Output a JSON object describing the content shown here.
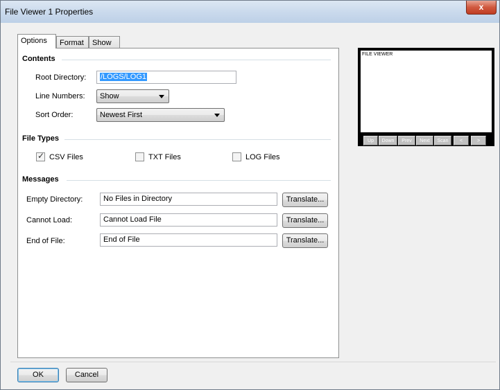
{
  "window": {
    "title": "File Viewer 1 Properties",
    "close_glyph": "x"
  },
  "tabs": [
    {
      "label": "Options",
      "active": true
    },
    {
      "label": "Format",
      "active": false
    },
    {
      "label": "Show",
      "active": false
    }
  ],
  "contents": {
    "heading": "Contents",
    "root_directory": {
      "label": "Root Directory:",
      "value": "/LOGS/LOG1"
    },
    "line_numbers": {
      "label": "Line Numbers:",
      "value": "Show"
    },
    "sort_order": {
      "label": "Sort Order:",
      "value": "Newest First"
    }
  },
  "file_types": {
    "heading": "File Types",
    "csv": {
      "label": "CSV Files",
      "checked": true
    },
    "txt": {
      "label": "TXT Files",
      "checked": false
    },
    "log": {
      "label": "LOG Files",
      "checked": false
    }
  },
  "messages": {
    "heading": "Messages",
    "translate_label": "Translate...",
    "empty_directory": {
      "label": "Empty Directory:",
      "value": "No Files in Directory"
    },
    "cannot_load": {
      "label": "Cannot Load:",
      "value": "Cannot Load File"
    },
    "end_of_file": {
      "label": "End of File:",
      "value": "End of File"
    }
  },
  "preview": {
    "screen_text": "FILE VIEWER",
    "buttons": [
      "Up",
      "Down",
      "Prev",
      "Next",
      "Scan",
      "<",
      ">"
    ]
  },
  "footer": {
    "ok_label": "OK",
    "cancel_label": "Cancel"
  }
}
